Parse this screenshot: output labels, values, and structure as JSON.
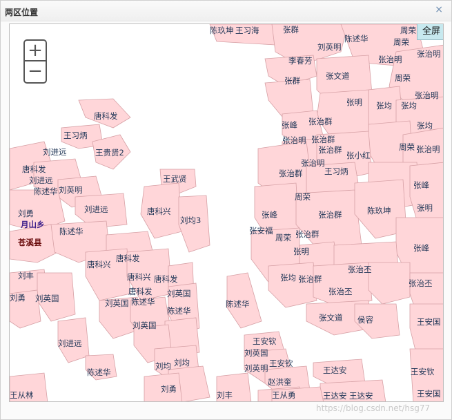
{
  "window": {
    "title": "两区位置",
    "close_glyph": "×"
  },
  "map": {
    "fill_color": "#ffd6d9",
    "stroke_color": "#d6a0a5",
    "label_color": "#1f3556",
    "zoom_in": "+",
    "zoom_out": "−",
    "fullscreen": "全屏",
    "town_label": "月山乡",
    "county_label": "苍溪县",
    "parcel_labels": [
      "陈玖坤",
      "王习海",
      "张群",
      "周荣",
      "陈述华",
      "刘英明",
      "周荣",
      "张治明",
      "李春芳",
      "张治明",
      "张文道",
      "周荣",
      "张群",
      "张治明",
      "张明",
      "张均",
      "张均",
      "唐科发",
      "张峰",
      "张治群",
      "张均",
      "王习炳",
      "张治群",
      "周荣",
      "张治明",
      "刘进远",
      "王贵贤2",
      "张治群",
      "张小红",
      "唐科发",
      "张治明",
      "刘进远",
      "张治明",
      "张治群",
      "王习炳",
      "陈述华",
      "刘英明",
      "王武贤",
      "张峰",
      "刘勇",
      "唐科兴",
      "刘均3",
      "周荣",
      "张明",
      "月山乡",
      "陈述华",
      "刘进远",
      "张峰",
      "张治群",
      "陈玖坤",
      "张安福",
      "周荣",
      "张治群",
      "苍溪县",
      "唐科发",
      "张明",
      "张峰",
      "唐科兴",
      "刘丰",
      "唐科兴",
      "唐科发",
      "张均",
      "张治群",
      "张治丕",
      "张治丕",
      "刘勇",
      "刘英国",
      "唐科发",
      "刘英国",
      "张治丕",
      "刘英国",
      "陈述华",
      "陈述华",
      "陈述华",
      "张文道",
      "侯容",
      "王安国",
      "刘英国",
      "刘进远",
      "王安钦",
      "刘英国",
      "王安钦",
      "刘均",
      "刘均",
      "刘英明",
      "王达安",
      "王安钦",
      "陈述华",
      "赵洪奎",
      "刘勇",
      "王从林",
      "刘丰",
      "王从勇",
      "王达安",
      "王达安",
      "王安国"
    ],
    "watermark": "https://blog.csdn.net/hsg77"
  }
}
